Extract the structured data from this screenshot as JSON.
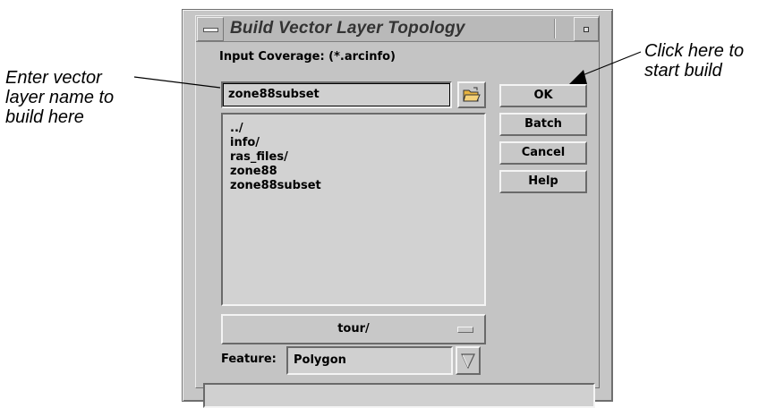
{
  "window": {
    "title": "Build Vector Layer Topology"
  },
  "input": {
    "label": "Input Coverage: (*.arcinfo)",
    "value": "zone88subset"
  },
  "file_list": [
    "../",
    "info/",
    "ras_files/",
    "zone88",
    "zone88subset"
  ],
  "directory": {
    "selected": "tour/"
  },
  "feature": {
    "label": "Feature:",
    "selected": "Polygon"
  },
  "buttons": {
    "ok": "OK",
    "batch": "Batch",
    "cancel": "Cancel",
    "help": "Help"
  },
  "annotations": {
    "left": [
      "Enter vector",
      "layer name to",
      "build here"
    ],
    "right": [
      "Click here to",
      "start build"
    ]
  },
  "icons": {
    "title_menu": "window-menu-icon",
    "title_max": "maximize-icon",
    "folder": "open-folder-icon",
    "dropdown": "dropdown-indicator-icon",
    "combo_arrow": "down-arrow-icon"
  },
  "colors": {
    "dialog_bg": "#c6c6c6",
    "field_bg": "#d0d0d0",
    "folder_icon": "#e8b440"
  }
}
